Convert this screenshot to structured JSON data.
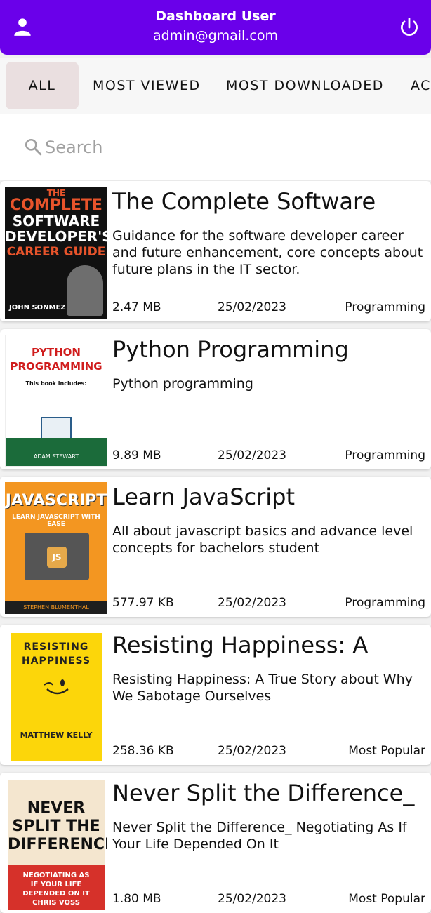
{
  "header": {
    "user_name": "Dashboard User",
    "email": "admin@gmail.com",
    "bg_color": "#6a00ea"
  },
  "tabs": [
    {
      "label": "ALL",
      "active": true
    },
    {
      "label": "MOST VIEWED",
      "active": false
    },
    {
      "label": "MOST DOWNLOADED",
      "active": false
    },
    {
      "label": "AC",
      "active": false
    }
  ],
  "search": {
    "placeholder": "Search"
  },
  "books": [
    {
      "title": "The Complete Software",
      "description": "Guidance for the software developer career and future enhancement, core concepts about future plans in the IT sector.",
      "size": "2.47 MB",
      "date": "25/02/2023",
      "category": "Programming",
      "cover": {
        "l1": "THE",
        "l2": "COMPLETE",
        "l3": "SOFTWARE",
        "l4": "DEVELOPER'S",
        "l5": "CAREER GUIDE",
        "author": "JOHN SONMEZ"
      }
    },
    {
      "title": "Python Programming",
      "description": "Python programming",
      "size": "9.89 MB",
      "date": "25/02/2023",
      "category": "Programming",
      "cover": {
        "l1": "PYTHON",
        "l2": "PROGRAMMING",
        "l3": "This book includes:",
        "author": "ADAM STEWART"
      }
    },
    {
      "title": "Learn JavaScript",
      "description": "All about javascript basics and advance level concepts for bachelors student",
      "size": "577.97 KB",
      "date": "25/02/2023",
      "category": "Programming",
      "cover": {
        "l1": "JAVASCRIPT",
        "l2": "LEARN JAVASCRIPT WITH EASE",
        "badge": "JS",
        "author": "STEPHEN BLUMENTHAL"
      }
    },
    {
      "title": "Resisting Happiness: A",
      "description": "Resisting Happiness: A True Story about Why We Sabotage Ourselves",
      "size": "258.36 KB",
      "date": "25/02/2023",
      "category": "Most Popular",
      "cover": {
        "l1": "RESISTING",
        "l2": "HAPPINESS",
        "author": "MATTHEW KELLY"
      }
    },
    {
      "title": "Never Split the Difference_",
      "description": "Never Split the Difference_ Negotiating As If Your Life Depended On It",
      "size": "1.80 MB",
      "date": "25/02/2023",
      "category": "Most Popular",
      "cover": {
        "l1": "NEVER",
        "l2": "SPLIT THE",
        "l3": "DIFFERENCE",
        "l4": "NEGOTIATING AS",
        "l5": "IF YOUR LIFE",
        "l6": "DEPENDED ON IT",
        "author": "CHRIS VOSS"
      }
    }
  ]
}
